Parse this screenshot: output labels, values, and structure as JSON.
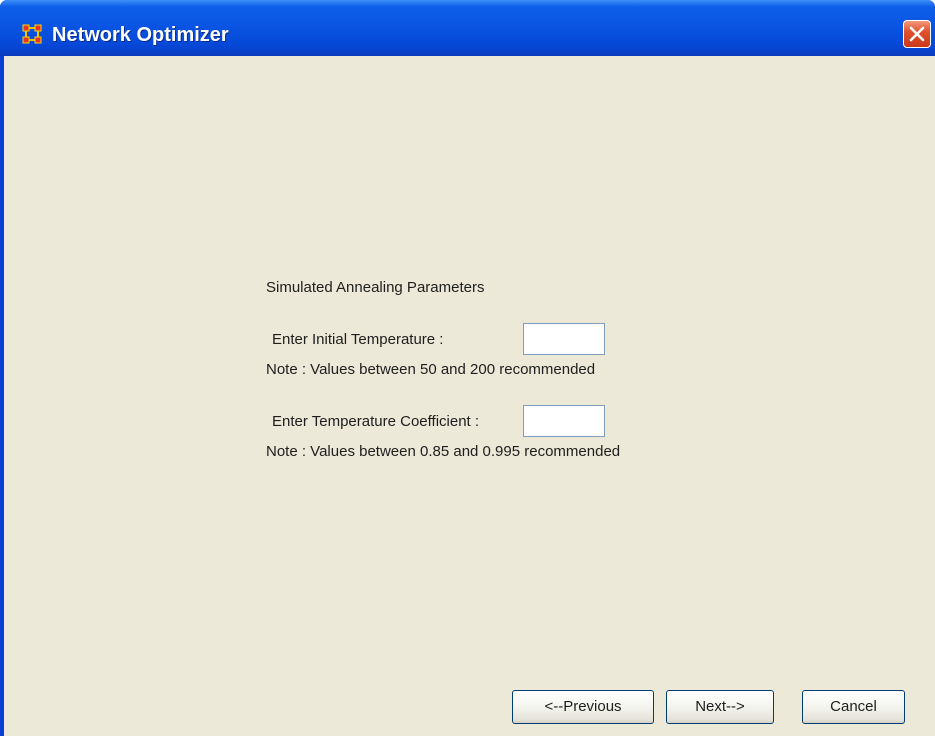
{
  "window": {
    "title": "Network Optimizer",
    "icon": "network-nodes-icon",
    "close_icon": "close-icon"
  },
  "form": {
    "section_title": "Simulated Annealing Parameters",
    "initial_temperature": {
      "label": "Enter Initial Temperature :",
      "value": "",
      "note": "Note : Values between 50 and 200 recommended"
    },
    "temperature_coefficient": {
      "label": "Enter Temperature Coefficient :",
      "value": "",
      "note": "Note : Values between 0.85 and 0.995 recommended"
    }
  },
  "buttons": {
    "previous": "<--Previous",
    "next": "Next-->",
    "cancel": "Cancel"
  },
  "colors": {
    "titlebar": "#0a55e3",
    "client_background": "#ece9d8",
    "close_button": "#e0532e",
    "input_border": "#7f9db9"
  }
}
